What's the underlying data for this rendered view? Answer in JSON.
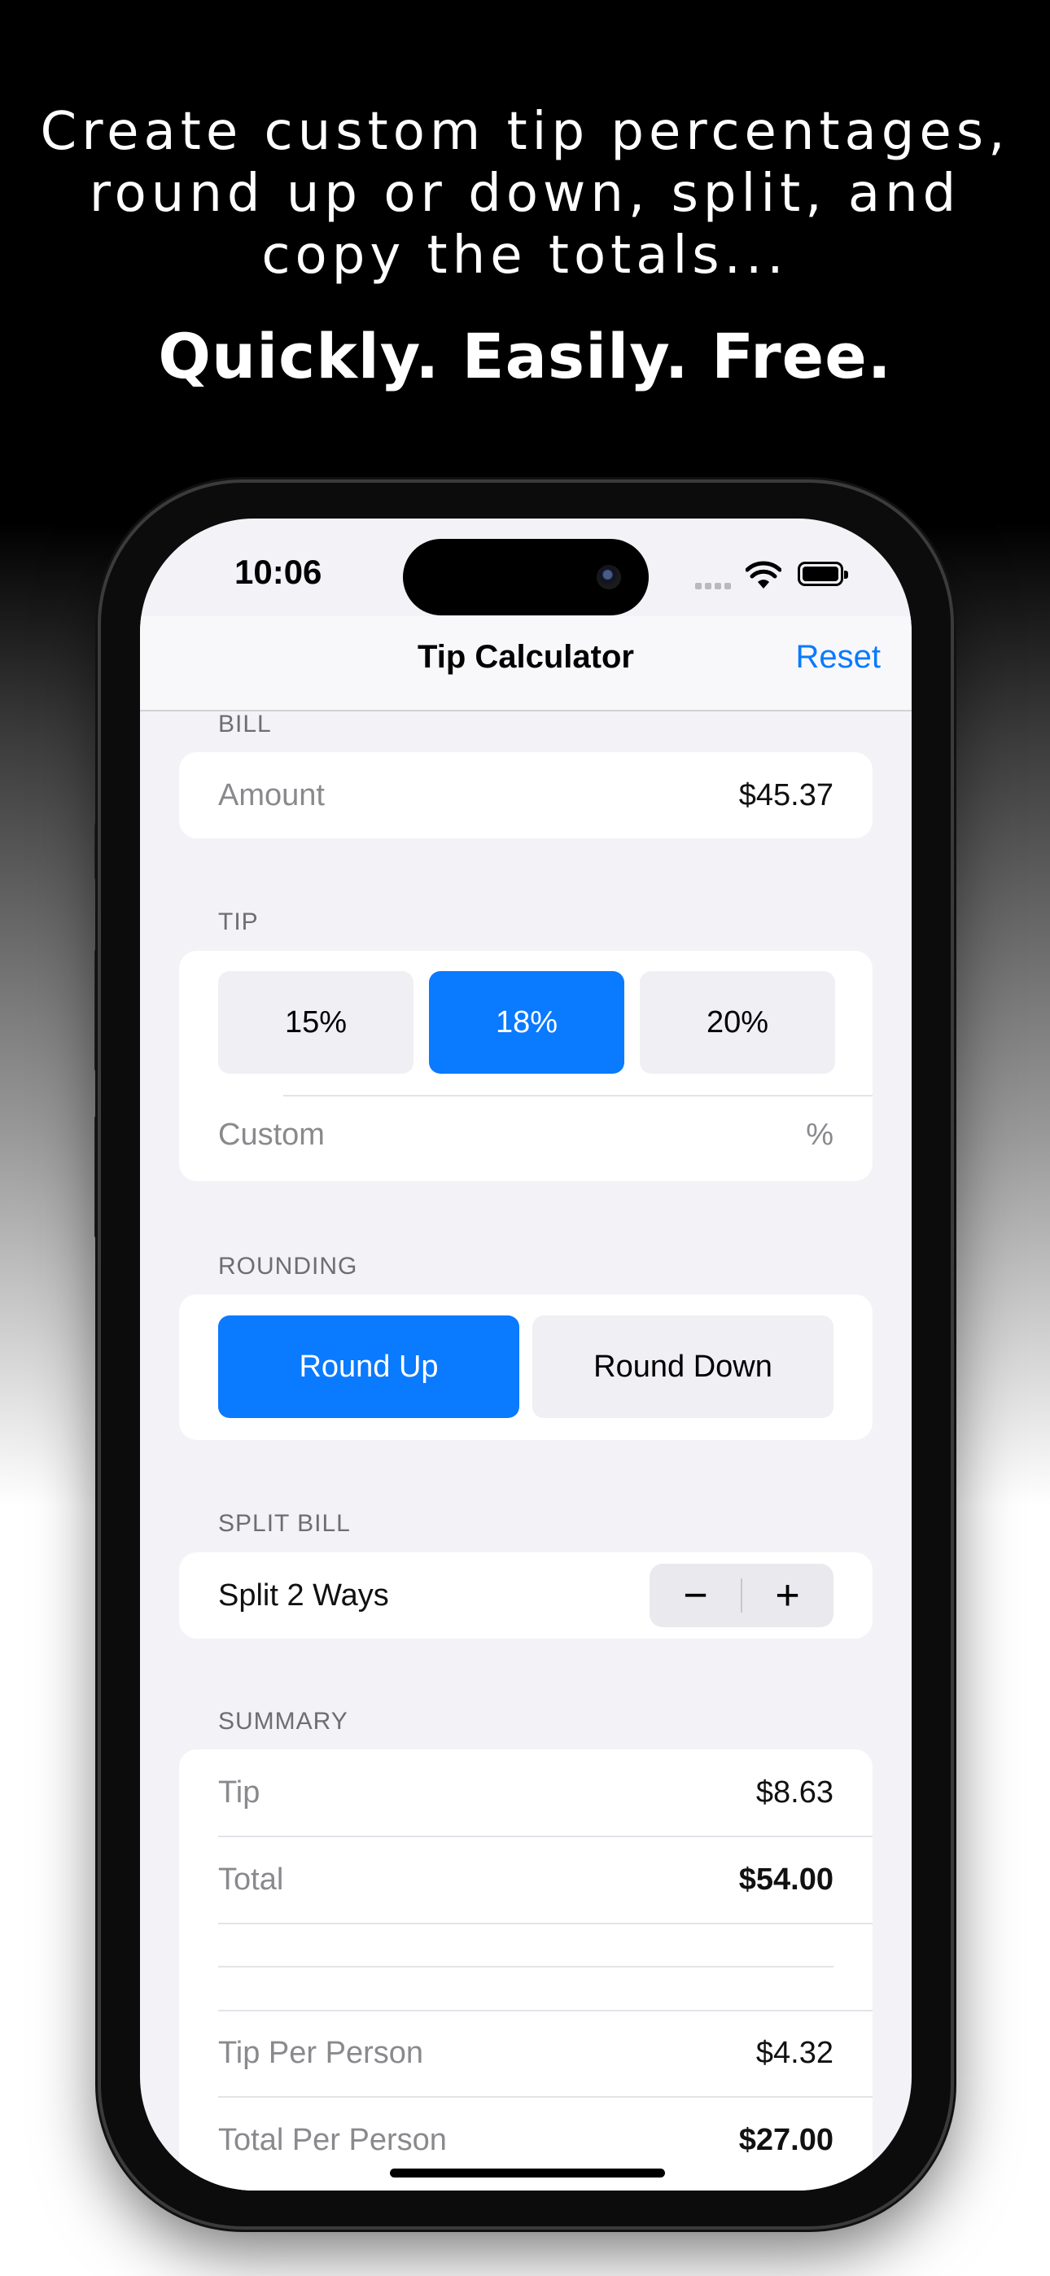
{
  "marketing": {
    "headline_line1": "Create custom tip percentages,",
    "headline_line2": "round up or down, split, and",
    "headline_line3": "copy the totals...",
    "tagline": "Quickly. Easily. Free."
  },
  "status_bar": {
    "time": "10:06"
  },
  "nav": {
    "title": "Tip Calculator",
    "reset_label": "Reset"
  },
  "bill": {
    "section_label": "BILL",
    "amount_label": "Amount",
    "amount_value": "$45.37"
  },
  "tip": {
    "section_label": "TIP",
    "options": [
      "15%",
      "18%",
      "20%"
    ],
    "selected": "18%",
    "custom_label": "Custom",
    "custom_suffix": "%"
  },
  "rounding": {
    "section_label": "ROUNDING",
    "round_up_label": "Round Up",
    "round_down_label": "Round Down",
    "selected": "Round Up"
  },
  "split": {
    "section_label": "SPLIT BILL",
    "label": "Split 2 Ways",
    "minus": "−",
    "plus": "+"
  },
  "summary": {
    "section_label": "SUMMARY",
    "tip_label": "Tip",
    "tip_value": "$8.63",
    "total_label": "Total",
    "total_value": "$54.00",
    "tip_per_person_label": "Tip Per Person",
    "tip_per_person_value": "$4.32",
    "total_per_person_label": "Total Per Person",
    "total_per_person_value": "$27.00"
  },
  "colors": {
    "accent": "#0a7aff",
    "background": "#f2f2f7"
  }
}
